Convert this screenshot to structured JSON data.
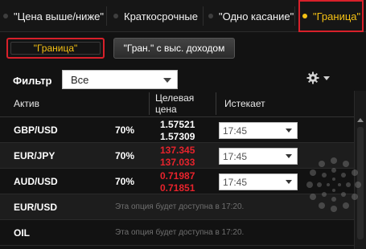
{
  "tabs": [
    {
      "label": "\"Цена выше/ниже\"",
      "active": false
    },
    {
      "label": "Краткосрочные",
      "active": false
    },
    {
      "label": "\"Одно касание\"",
      "active": false
    },
    {
      "label": "\"Граница\"",
      "active": true
    }
  ],
  "subtabs": [
    {
      "label": "\"Граница\"",
      "active": true
    },
    {
      "label": "\"Гран.\" с выс. доходом",
      "active": false
    }
  ],
  "filter": {
    "label": "Фильтр",
    "value": "Все"
  },
  "settings": {
    "icon": "gear-icon"
  },
  "table": {
    "headers": {
      "asset": "Актив",
      "target_price": "Целевая цена",
      "expires": "Истекает"
    },
    "rows": [
      {
        "asset": "GBP/USD",
        "payout": "70%",
        "price_high": "1.57521",
        "price_low": "1.57309",
        "price_color": "white",
        "expiry": "17:45",
        "note": ""
      },
      {
        "asset": "EUR/JPY",
        "payout": "70%",
        "price_high": "137.345",
        "price_low": "137.033",
        "price_color": "red",
        "expiry": "17:45",
        "note": ""
      },
      {
        "asset": "AUD/USD",
        "payout": "70%",
        "price_high": "0.71987",
        "price_low": "0.71851",
        "price_color": "red",
        "expiry": "17:45",
        "note": ""
      },
      {
        "asset": "EUR/USD",
        "payout": "",
        "price_high": "",
        "price_low": "",
        "price_color": "",
        "expiry": "",
        "note": "Эта опция будет доступна в 17:20."
      },
      {
        "asset": "OIL",
        "payout": "",
        "price_high": "",
        "price_low": "",
        "price_color": "",
        "expiry": "",
        "note": "Эта опция будет доступна в 17:20."
      }
    ]
  },
  "colors": {
    "accent": "#f6c214",
    "highlight_frame": "#d8202a",
    "price_down": "#e8232c",
    "background": "#121212"
  }
}
